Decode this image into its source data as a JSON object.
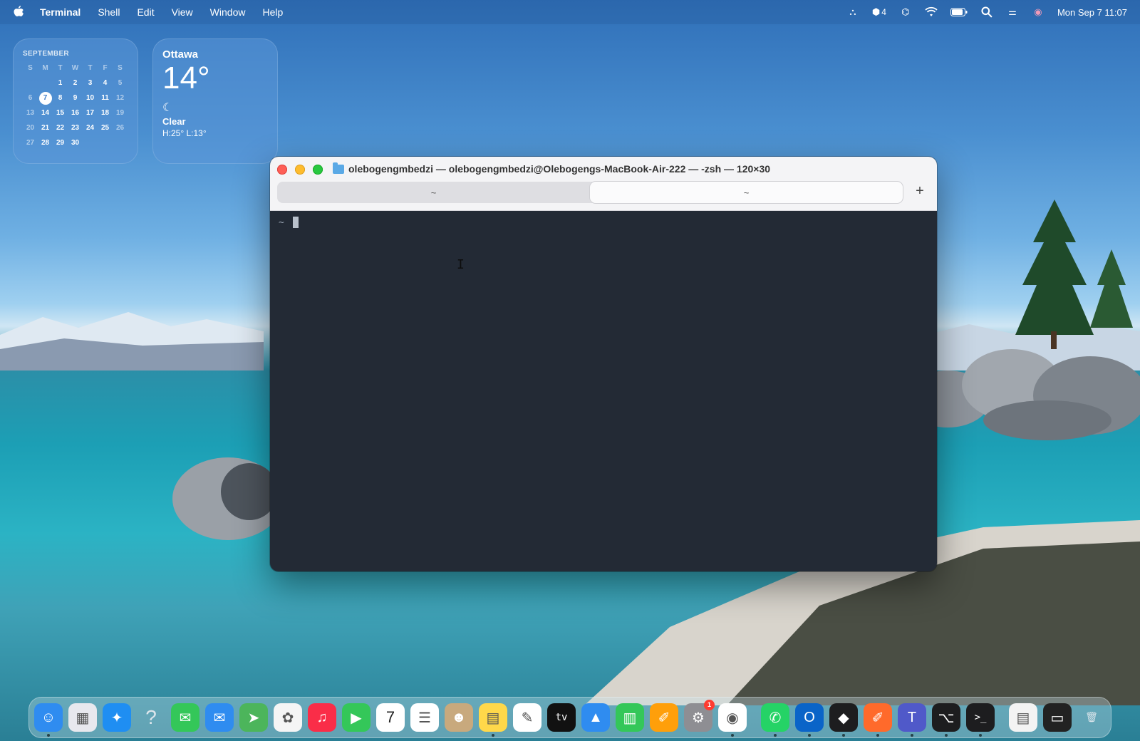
{
  "menubar": {
    "app_name": "Terminal",
    "items": [
      "Shell",
      "Edit",
      "View",
      "Window",
      "Help"
    ],
    "status": {
      "extension_count": "4",
      "datetime": "Mon Sep 7  11:07"
    }
  },
  "calendar_widget": {
    "month": "SEPTEMBER",
    "weekdays": [
      "S",
      "M",
      "T",
      "W",
      "T",
      "F",
      "S"
    ],
    "weeks": [
      [
        "",
        "",
        "1",
        "2",
        "3",
        "4",
        "5"
      ],
      [
        "6",
        "7",
        "8",
        "9",
        "10",
        "11",
        "12"
      ],
      [
        "13",
        "14",
        "15",
        "16",
        "17",
        "18",
        "19"
      ],
      [
        "20",
        "21",
        "22",
        "23",
        "24",
        "25",
        "26"
      ],
      [
        "27",
        "28",
        "29",
        "30",
        "",
        "",
        ""
      ]
    ],
    "today": "7"
  },
  "weather_widget": {
    "city": "Ottawa",
    "temp": "14°",
    "condition": "Clear",
    "high_low": "H:25° L:13°"
  },
  "terminal": {
    "title": "olebogengmbedzi — olebogengmbedzi@Olebogengs-MacBook-Air-222 — -zsh — 120×30",
    "tabs": [
      {
        "label": "~",
        "active": false
      },
      {
        "label": "~",
        "active": true
      }
    ],
    "new_tab": "+",
    "prompt": "~"
  },
  "dock": {
    "apps": [
      {
        "name": "finder",
        "glyph": "☺",
        "color": "#2f8cf0",
        "running": true
      },
      {
        "name": "launchpad",
        "glyph": "▦",
        "color": "#e8e8ee",
        "running": false
      },
      {
        "name": "safari",
        "glyph": "✦",
        "color": "#1f8ef2",
        "running": false
      },
      {
        "name": "help",
        "glyph": "?",
        "color": "transparent",
        "running": false
      },
      {
        "name": "messages",
        "glyph": "✉",
        "color": "#34c759",
        "running": false
      },
      {
        "name": "mail",
        "glyph": "✉",
        "color": "#2f8cf0",
        "running": false
      },
      {
        "name": "maps",
        "glyph": "➤",
        "color": "#4cb55b",
        "running": false
      },
      {
        "name": "photos",
        "glyph": "✿",
        "color": "#f5f5f5",
        "running": false
      },
      {
        "name": "music",
        "glyph": "♫",
        "color": "#fa2d48",
        "running": false
      },
      {
        "name": "facetime",
        "glyph": "▶",
        "color": "#34c759",
        "running": false
      },
      {
        "name": "calendar",
        "glyph": "7",
        "color": "#ffffff",
        "running": false
      },
      {
        "name": "reminders",
        "glyph": "☰",
        "color": "#ffffff",
        "running": false
      },
      {
        "name": "contacts",
        "glyph": "☻",
        "color": "#c8a97d",
        "running": false
      },
      {
        "name": "notes",
        "glyph": "▤",
        "color": "#ffd84a",
        "running": true
      },
      {
        "name": "freeform",
        "glyph": "✎",
        "color": "#ffffff",
        "running": false
      },
      {
        "name": "apple-tv",
        "glyph": "tv",
        "color": "#111111",
        "running": false
      },
      {
        "name": "keynote",
        "glyph": "▲",
        "color": "#2f8cf0",
        "running": false
      },
      {
        "name": "numbers",
        "glyph": "▥",
        "color": "#34c759",
        "running": false
      },
      {
        "name": "pages",
        "glyph": "✐",
        "color": "#ff9f0a",
        "running": false
      },
      {
        "name": "system-settings",
        "glyph": "⚙",
        "color": "#8e8e93",
        "running": false,
        "badge": "1"
      },
      {
        "name": "chrome",
        "glyph": "◉",
        "color": "#ffffff",
        "running": true
      },
      {
        "name": "whatsapp",
        "glyph": "✆",
        "color": "#25d366",
        "running": true
      },
      {
        "name": "outlook",
        "glyph": "O",
        "color": "#0a64c8",
        "running": true
      },
      {
        "name": "cursor",
        "glyph": "◆",
        "color": "#1d1d1f",
        "running": true
      },
      {
        "name": "swift-playgrounds",
        "glyph": "✐",
        "color": "#ff6a2b",
        "running": true
      },
      {
        "name": "teams",
        "glyph": "T",
        "color": "#5059c9",
        "running": true
      },
      {
        "name": "github-desktop",
        "glyph": "⌥",
        "color": "#1d1d1f",
        "running": true
      },
      {
        "name": "terminal",
        "glyph": ">_",
        "color": "#1d1d1f",
        "running": true
      },
      {
        "name": "document-preview",
        "glyph": "▤",
        "color": "#f3f3f3",
        "running": false
      },
      {
        "name": "recent-window",
        "glyph": "▭",
        "color": "#222222",
        "running": false
      },
      {
        "name": "trash",
        "glyph": "🗑",
        "color": "transparent",
        "running": false
      }
    ]
  }
}
